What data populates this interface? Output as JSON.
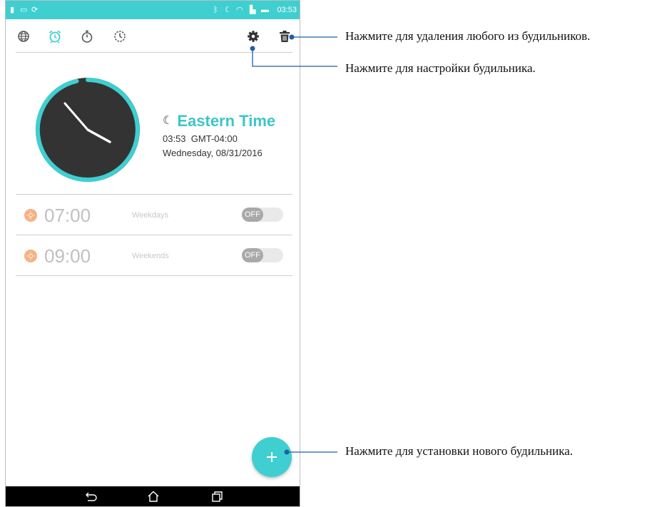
{
  "status_bar": {
    "time": "03:53"
  },
  "tabs": [
    {
      "icon": "globe-icon",
      "name": "world-clock"
    },
    {
      "icon": "alarm-clock-icon",
      "name": "alarm",
      "active": true
    },
    {
      "icon": "stopwatch-icon",
      "name": "stopwatch"
    },
    {
      "icon": "timer-icon",
      "name": "timer"
    }
  ],
  "toolbar": {
    "settings_icon": "gear-icon",
    "delete_icon": "trash-icon"
  },
  "world_clock": {
    "timezone_name": "Eastern Time",
    "time": "03:53",
    "gmt_offset": "GMT-04:00",
    "date": "Wednesday, 08/31/2016"
  },
  "alarms": [
    {
      "time": "07:00",
      "days": "Weekdays",
      "toggle": "OFF"
    },
    {
      "time": "09:00",
      "days": "Weekends",
      "toggle": "OFF"
    }
  ],
  "fab": {
    "icon": "plus-icon"
  },
  "nav": {
    "back_icon": "back-icon",
    "home_icon": "home-icon",
    "recents_icon": "recents-icon"
  },
  "callouts": {
    "delete": "Нажмите для удаления любого из будильников.",
    "settings": "Нажмите для настройки будильника.",
    "add": "Нажмите для установки нового будильника."
  },
  "colors": {
    "accent": "#3fcfd0",
    "clock_face": "#333333",
    "alarm_icon": "#f6b184",
    "callout_line": "#1f5fa5"
  }
}
